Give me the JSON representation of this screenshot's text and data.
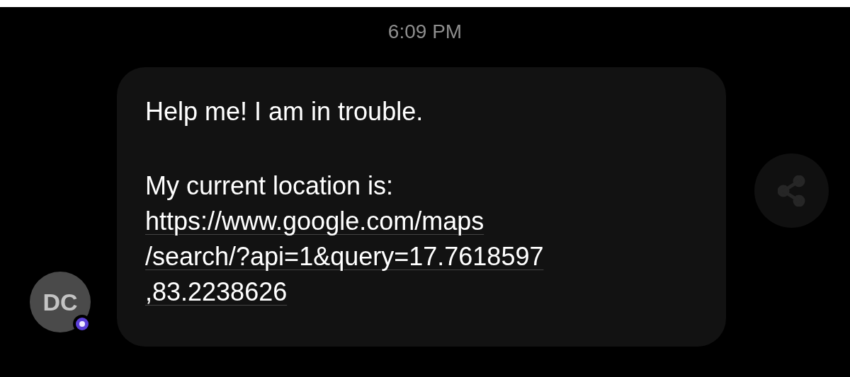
{
  "timestamp": "6:09 PM",
  "message": {
    "paragraphs": [
      "Help me! I am in trouble.",
      "My current location is:"
    ],
    "link_lines": [
      "https://www.google.com/maps",
      "/search/?api=1&query=17.7618597",
      ",83.2238626"
    ]
  },
  "sender": {
    "initials": "DC",
    "online": true
  }
}
